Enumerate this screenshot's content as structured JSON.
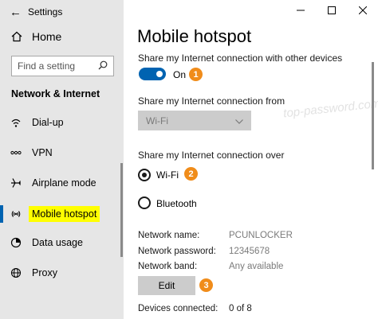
{
  "window": {
    "title": "Settings"
  },
  "sidebar": {
    "home_label": "Home",
    "search_placeholder": "Find a setting",
    "section_title": "Network & Internet",
    "items": [
      {
        "label": "Dial-up",
        "icon": "dialup-icon"
      },
      {
        "label": "VPN",
        "icon": "vpn-icon"
      },
      {
        "label": "Airplane mode",
        "icon": "airplane-icon"
      },
      {
        "label": "Mobile hotspot",
        "icon": "hotspot-icon",
        "selected": true
      },
      {
        "label": "Data usage",
        "icon": "data-usage-icon"
      },
      {
        "label": "Proxy",
        "icon": "globe-icon"
      }
    ]
  },
  "main": {
    "title": "Mobile hotspot",
    "share_label": "Share my Internet connection with other devices",
    "toggle_state": "On",
    "from_label": "Share my Internet connection from",
    "from_value": "Wi-Fi",
    "over_label": "Share my Internet connection over",
    "over_options": [
      "Wi-Fi",
      "Bluetooth"
    ],
    "over_selected": "Wi-Fi",
    "network_name_label": "Network name:",
    "network_name_value": "PCUNLOCKER",
    "network_password_label": "Network password:",
    "network_password_value": "12345678",
    "network_band_label": "Network band:",
    "network_band_value": "Any available",
    "edit_label": "Edit",
    "devices_label": "Devices connected:",
    "devices_value": "0 of 8"
  },
  "annotations": {
    "badge1": "1",
    "badge2": "2",
    "badge3": "3"
  },
  "watermark": "top-password.com",
  "colors": {
    "accent": "#0063b1",
    "badge": "#f08c1a",
    "highlight": "#ffff00",
    "sidebar_bg": "#e6e6e6"
  }
}
